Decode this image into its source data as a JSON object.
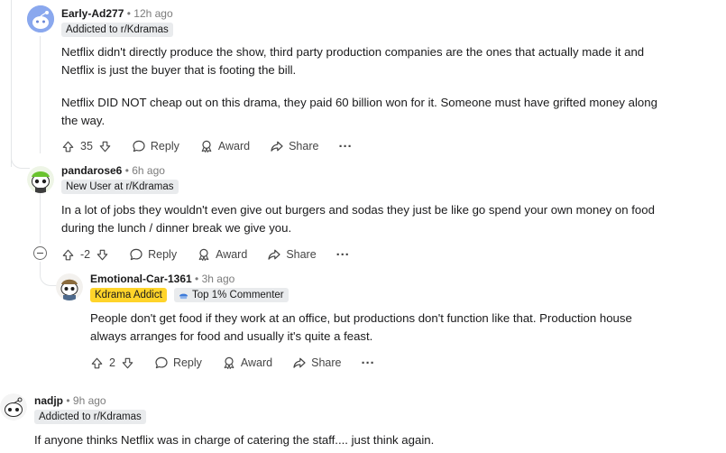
{
  "comments": [
    {
      "username": "Early-Ad277",
      "time": "12h ago",
      "flair": "Addicted to r/Kdramas",
      "paragraphs": [
        "Netflix didn't directly produce the show, third party production companies are the ones that actually made it and Netflix is just the buyer that is footing the bill.",
        "Netflix DID NOT cheap out on this drama, they paid 60 billion won for it. Someone must have grifted money along the way."
      ],
      "score": "35"
    },
    {
      "username": "pandarose6",
      "time": "6h ago",
      "flair": "New User at r/Kdramas",
      "paragraphs": [
        "In a lot of jobs they wouldn't even give out burgers and sodas they just be like go spend your own money on food during the lunch / dinner break we give you."
      ],
      "score": "-2"
    },
    {
      "username": "Emotional-Car-1361",
      "time": "3h ago",
      "flair": "Kdrama Addict",
      "flair2": "Top 1% Commenter",
      "paragraphs": [
        "People don't get food if they work at an office, but productions don't function like that. Production house always arranges for food and usually it's quite a feast."
      ],
      "score": "2"
    },
    {
      "username": "nadjp",
      "time": "9h ago",
      "flair": "Addicted to r/Kdramas",
      "paragraphs": [
        "If anyone thinks Netflix was in charge of catering the staff.... just think again."
      ]
    }
  ],
  "actions": {
    "reply": "Reply",
    "award": "Award",
    "share": "Share",
    "more": "···"
  },
  "separator": "•",
  "icons": {
    "upvote": "upvote-arrow-icon",
    "downvote": "downvote-arrow-icon",
    "reply": "chat-bubble-icon",
    "award": "award-ribbon-icon",
    "share": "share-arrow-icon",
    "more": "more-dots-icon",
    "collapse": "collapse-minus-icon",
    "top-commenter": "top-commenter-icon"
  },
  "colors": {
    "flair_bg": "#e9ebed",
    "gold_flair": "#ffd42a",
    "thread_line": "#e4e6e8",
    "meta_text": "#7c7c7c"
  }
}
